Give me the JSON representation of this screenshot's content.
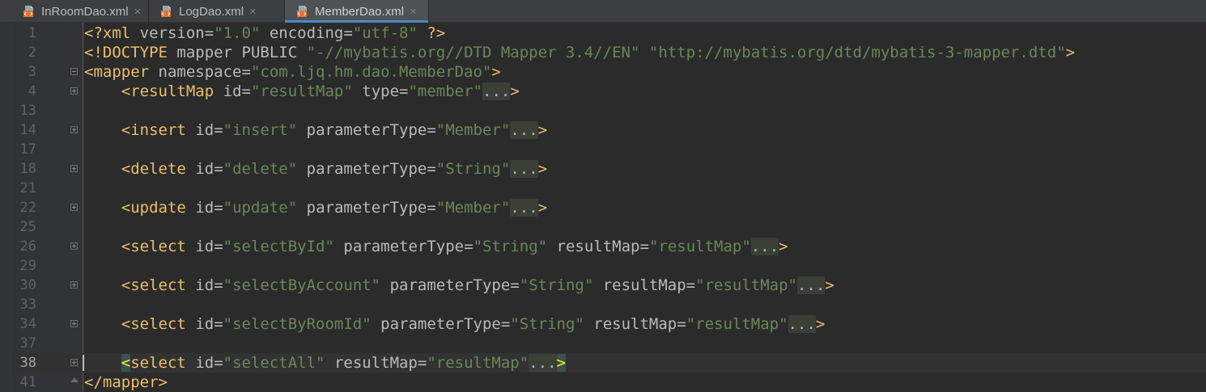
{
  "tabs": [
    {
      "label": "InRoomDao.xml",
      "icon": "xml-file-icon",
      "active": false
    },
    {
      "label": "LogDao.xml",
      "icon": "xml-file-icon",
      "active": false
    },
    {
      "label": "MemberDao.xml",
      "icon": "xml-file-icon",
      "active": true
    }
  ],
  "close_glyph": "×",
  "fold_placeholder": "...",
  "editor": {
    "current_line_number": "38",
    "lines": [
      {
        "num": "1",
        "fold": "none",
        "tokens": [
          {
            "t": "bracket",
            "v": "<?"
          },
          {
            "t": "tag",
            "v": "xml"
          },
          {
            "t": "plain",
            "v": " "
          },
          {
            "t": "attr",
            "v": "version"
          },
          {
            "t": "eq",
            "v": "="
          },
          {
            "t": "str",
            "v": "\"1.0\""
          },
          {
            "t": "plain",
            "v": " "
          },
          {
            "t": "attr",
            "v": "encoding"
          },
          {
            "t": "eq",
            "v": "="
          },
          {
            "t": "str",
            "v": "\"utf-8\""
          },
          {
            "t": "plain",
            "v": " "
          },
          {
            "t": "bracket",
            "v": "?>"
          }
        ]
      },
      {
        "num": "2",
        "fold": "none",
        "tokens": [
          {
            "t": "bracket",
            "v": "<!"
          },
          {
            "t": "tag",
            "v": "DOCTYPE"
          },
          {
            "t": "plain",
            "v": " "
          },
          {
            "t": "attr",
            "v": "mapper"
          },
          {
            "t": "plain",
            "v": " "
          },
          {
            "t": "attr",
            "v": "PUBLIC"
          },
          {
            "t": "plain",
            "v": " "
          },
          {
            "t": "str",
            "v": "\"-//mybatis.org//DTD Mapper 3.4//EN\""
          },
          {
            "t": "plain",
            "v": " "
          },
          {
            "t": "str",
            "v": "\"http://mybatis.org/dtd/mybatis-3-mapper.dtd\""
          },
          {
            "t": "bracket",
            "v": ">"
          }
        ]
      },
      {
        "num": "3",
        "fold": "open",
        "tokens": [
          {
            "t": "bracket",
            "v": "<"
          },
          {
            "t": "tag",
            "v": "mapper"
          },
          {
            "t": "plain",
            "v": " "
          },
          {
            "t": "attr",
            "v": "namespace"
          },
          {
            "t": "eq",
            "v": "="
          },
          {
            "t": "str",
            "v": "\"com.ljq.hm.dao.MemberDao\""
          },
          {
            "t": "bracket",
            "v": ">"
          }
        ]
      },
      {
        "num": "4",
        "fold": "collapsed",
        "tokens": [
          {
            "t": "plain",
            "v": "    "
          },
          {
            "t": "bracket",
            "v": "<"
          },
          {
            "t": "tag",
            "v": "resultMap"
          },
          {
            "t": "plain",
            "v": " "
          },
          {
            "t": "attr",
            "v": "id"
          },
          {
            "t": "eq",
            "v": "="
          },
          {
            "t": "str",
            "v": "\"resultMap\""
          },
          {
            "t": "plain",
            "v": " "
          },
          {
            "t": "attr",
            "v": "type"
          },
          {
            "t": "eq",
            "v": "="
          },
          {
            "t": "str",
            "v": "\"member\""
          },
          {
            "t": "fold",
            "v": "..."
          },
          {
            "t": "bracket",
            "v": ">"
          }
        ]
      },
      {
        "num": "13",
        "fold": "none",
        "tokens": []
      },
      {
        "num": "14",
        "fold": "collapsed",
        "tokens": [
          {
            "t": "plain",
            "v": "    "
          },
          {
            "t": "bracket",
            "v": "<"
          },
          {
            "t": "tag",
            "v": "insert"
          },
          {
            "t": "plain",
            "v": " "
          },
          {
            "t": "attr",
            "v": "id"
          },
          {
            "t": "eq",
            "v": "="
          },
          {
            "t": "str",
            "v": "\"insert\""
          },
          {
            "t": "plain",
            "v": " "
          },
          {
            "t": "attr",
            "v": "parameterType"
          },
          {
            "t": "eq",
            "v": "="
          },
          {
            "t": "str",
            "v": "\"Member\""
          },
          {
            "t": "fold",
            "v": "..."
          },
          {
            "t": "bracket",
            "v": ">"
          }
        ]
      },
      {
        "num": "17",
        "fold": "none",
        "tokens": []
      },
      {
        "num": "18",
        "fold": "collapsed",
        "tokens": [
          {
            "t": "plain",
            "v": "    "
          },
          {
            "t": "bracket",
            "v": "<"
          },
          {
            "t": "tag",
            "v": "delete"
          },
          {
            "t": "plain",
            "v": " "
          },
          {
            "t": "attr",
            "v": "id"
          },
          {
            "t": "eq",
            "v": "="
          },
          {
            "t": "str",
            "v": "\"delete\""
          },
          {
            "t": "plain",
            "v": " "
          },
          {
            "t": "attr",
            "v": "parameterType"
          },
          {
            "t": "eq",
            "v": "="
          },
          {
            "t": "str",
            "v": "\"String\""
          },
          {
            "t": "fold",
            "v": "..."
          },
          {
            "t": "bracket",
            "v": ">"
          }
        ]
      },
      {
        "num": "21",
        "fold": "none",
        "tokens": []
      },
      {
        "num": "22",
        "fold": "collapsed",
        "tokens": [
          {
            "t": "plain",
            "v": "    "
          },
          {
            "t": "bracket",
            "v": "<"
          },
          {
            "t": "tag",
            "v": "update"
          },
          {
            "t": "plain",
            "v": " "
          },
          {
            "t": "attr",
            "v": "id"
          },
          {
            "t": "eq",
            "v": "="
          },
          {
            "t": "str",
            "v": "\"update\""
          },
          {
            "t": "plain",
            "v": " "
          },
          {
            "t": "attr",
            "v": "parameterType"
          },
          {
            "t": "eq",
            "v": "="
          },
          {
            "t": "str",
            "v": "\"Member\""
          },
          {
            "t": "fold",
            "v": "..."
          },
          {
            "t": "bracket",
            "v": ">"
          }
        ]
      },
      {
        "num": "25",
        "fold": "none",
        "tokens": []
      },
      {
        "num": "26",
        "fold": "collapsed",
        "tokens": [
          {
            "t": "plain",
            "v": "    "
          },
          {
            "t": "bracket",
            "v": "<"
          },
          {
            "t": "tag",
            "v": "select"
          },
          {
            "t": "plain",
            "v": " "
          },
          {
            "t": "attr",
            "v": "id"
          },
          {
            "t": "eq",
            "v": "="
          },
          {
            "t": "str",
            "v": "\"selectById\""
          },
          {
            "t": "plain",
            "v": " "
          },
          {
            "t": "attr",
            "v": "parameterType"
          },
          {
            "t": "eq",
            "v": "="
          },
          {
            "t": "str",
            "v": "\"String\""
          },
          {
            "t": "plain",
            "v": " "
          },
          {
            "t": "attr",
            "v": "resultMap"
          },
          {
            "t": "eq",
            "v": "="
          },
          {
            "t": "str",
            "v": "\"resultMap\""
          },
          {
            "t": "fold",
            "v": "..."
          },
          {
            "t": "bracket",
            "v": ">"
          }
        ]
      },
      {
        "num": "29",
        "fold": "none",
        "tokens": []
      },
      {
        "num": "30",
        "fold": "collapsed",
        "tokens": [
          {
            "t": "plain",
            "v": "    "
          },
          {
            "t": "bracket",
            "v": "<"
          },
          {
            "t": "tag",
            "v": "select"
          },
          {
            "t": "plain",
            "v": " "
          },
          {
            "t": "attr",
            "v": "id"
          },
          {
            "t": "eq",
            "v": "="
          },
          {
            "t": "str",
            "v": "\"selectByAccount\""
          },
          {
            "t": "plain",
            "v": " "
          },
          {
            "t": "attr",
            "v": "parameterType"
          },
          {
            "t": "eq",
            "v": "="
          },
          {
            "t": "str",
            "v": "\"String\""
          },
          {
            "t": "plain",
            "v": " "
          },
          {
            "t": "attr",
            "v": "resultMap"
          },
          {
            "t": "eq",
            "v": "="
          },
          {
            "t": "str",
            "v": "\"resultMap\""
          },
          {
            "t": "fold",
            "v": "..."
          },
          {
            "t": "bracket",
            "v": ">"
          }
        ]
      },
      {
        "num": "33",
        "fold": "none",
        "tokens": []
      },
      {
        "num": "34",
        "fold": "collapsed",
        "tokens": [
          {
            "t": "plain",
            "v": "    "
          },
          {
            "t": "bracket",
            "v": "<"
          },
          {
            "t": "tag",
            "v": "select"
          },
          {
            "t": "plain",
            "v": " "
          },
          {
            "t": "attr",
            "v": "id"
          },
          {
            "t": "eq",
            "v": "="
          },
          {
            "t": "str",
            "v": "\"selectByRoomId\""
          },
          {
            "t": "plain",
            "v": " "
          },
          {
            "t": "attr",
            "v": "parameterType"
          },
          {
            "t": "eq",
            "v": "="
          },
          {
            "t": "str",
            "v": "\"String\""
          },
          {
            "t": "plain",
            "v": " "
          },
          {
            "t": "attr",
            "v": "resultMap"
          },
          {
            "t": "eq",
            "v": "="
          },
          {
            "t": "str",
            "v": "\"resultMap\""
          },
          {
            "t": "fold",
            "v": "..."
          },
          {
            "t": "bracket",
            "v": ">"
          }
        ]
      },
      {
        "num": "37",
        "fold": "none",
        "tokens": []
      },
      {
        "num": "38",
        "fold": "collapsed",
        "current": true,
        "tokens": [
          {
            "t": "plain",
            "v": "    "
          },
          {
            "t": "match",
            "v": "<"
          },
          {
            "t": "tag",
            "v": "select"
          },
          {
            "t": "plain",
            "v": " "
          },
          {
            "t": "attr",
            "v": "id"
          },
          {
            "t": "eq",
            "v": "="
          },
          {
            "t": "str",
            "v": "\"selectAll\""
          },
          {
            "t": "plain",
            "v": " "
          },
          {
            "t": "attr",
            "v": "resultMap"
          },
          {
            "t": "eq",
            "v": "="
          },
          {
            "t": "str",
            "v": "\"resultMap\""
          },
          {
            "t": "fold",
            "v": "..."
          },
          {
            "t": "match",
            "v": ">"
          }
        ]
      },
      {
        "num": "41",
        "fold": "end",
        "tokens": [
          {
            "t": "bracket",
            "v": "</"
          },
          {
            "t": "tag",
            "v": "mapper"
          },
          {
            "t": "bracket",
            "v": ">"
          }
        ]
      }
    ]
  },
  "colors": {
    "background": "#2b2b2b",
    "gutter": "#313335",
    "tag": "#e8bf6a",
    "attribute": "#bababa",
    "string": "#6a8759",
    "line_number": "#606366",
    "active_tab_underline": "#4a88c7"
  }
}
